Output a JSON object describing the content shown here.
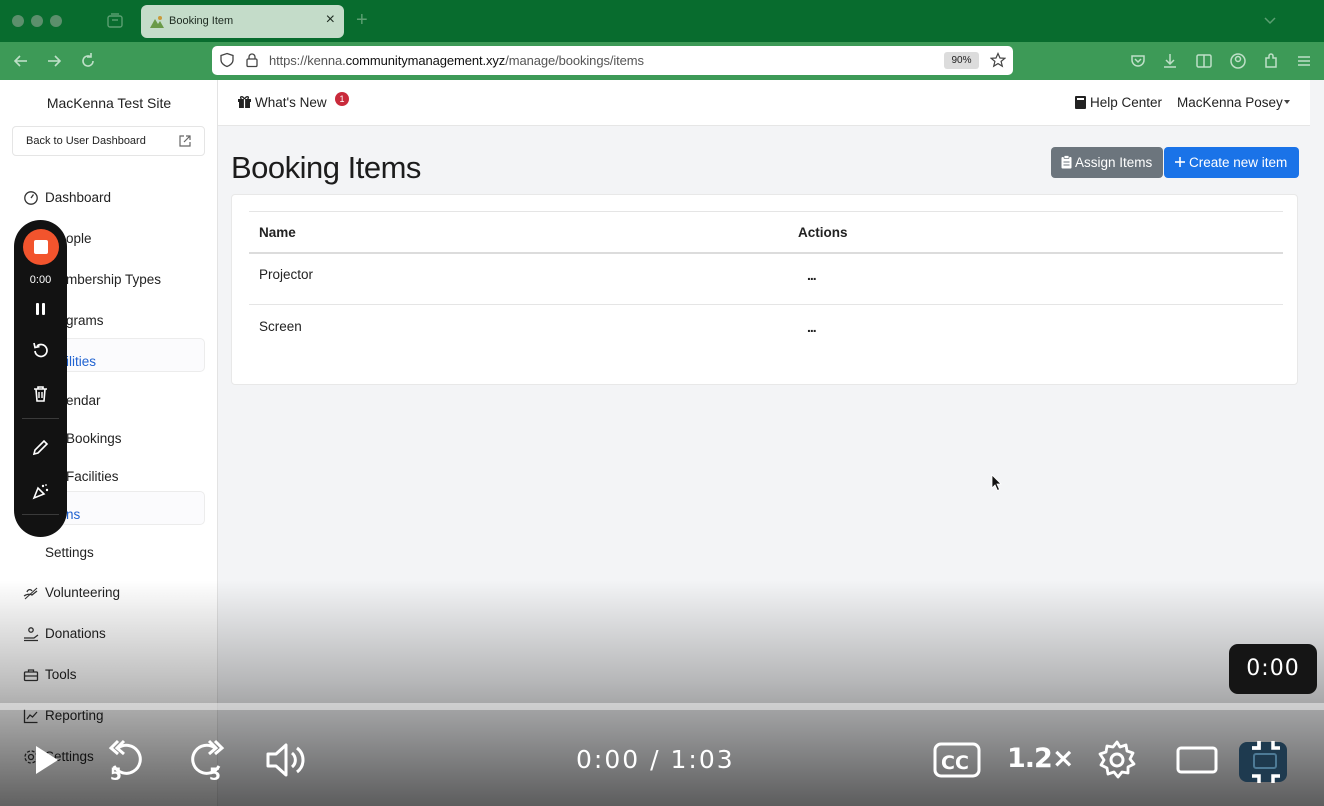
{
  "browser": {
    "tab_title": "Booking Item",
    "url_prefix": "https://kenna.",
    "url_domain": "communitymanagement.xyz",
    "url_path": "/manage/bookings/items",
    "zoom": "90%"
  },
  "sidebar": {
    "site_name": "MacKenna Test Site",
    "back_label": "Back to User Dashboard",
    "items": [
      {
        "label": "Dashboard"
      },
      {
        "label": "ople"
      },
      {
        "label": "mbership Types"
      },
      {
        "label": "grams"
      },
      {
        "label": "ilities"
      },
      {
        "label": "endar"
      },
      {
        "label": "Bookings"
      },
      {
        "label": "Facilities"
      },
      {
        "label": "ns"
      },
      {
        "label": "Settings"
      },
      {
        "label": "Volunteering"
      },
      {
        "label": "Donations"
      },
      {
        "label": "Tools"
      },
      {
        "label": "Reporting"
      },
      {
        "label": "Settings"
      }
    ]
  },
  "header": {
    "whats_new": "What's New",
    "whats_new_count": "1",
    "help_center": "Help Center",
    "user_name": "MacKenna Posey"
  },
  "main": {
    "title": "Booking Items",
    "assign_label": "Assign Items",
    "create_label": "Create new item",
    "table": {
      "headers": [
        "Name",
        "Actions"
      ],
      "rows": [
        {
          "name": "Projector",
          "actions": "..."
        },
        {
          "name": "Screen",
          "actions": "..."
        }
      ]
    }
  },
  "recorder": {
    "time": "0:00"
  },
  "video": {
    "time_pill": "0:00",
    "current": "0:00",
    "separator": "/",
    "duration": "1:03",
    "speed": "1.2×",
    "progress": 0
  },
  "colors": {
    "tabbar": "#086c2e",
    "navbar": "#3d9a57",
    "primary_button": "#1a73e8",
    "secondary_button": "#6c757d",
    "active_link": "#1f62d1",
    "record_stop": "#f2542d",
    "badge": "#c92a3b"
  },
  "icons": {
    "whats_new": "gift-icon",
    "help_center": "book-icon",
    "dashboard": "speedometer-icon",
    "volunteering": "hand-heart-icon",
    "donations": "donation-icon",
    "tools": "toolbox-icon",
    "reporting": "chart-line-icon",
    "settings": "gear-icon"
  }
}
